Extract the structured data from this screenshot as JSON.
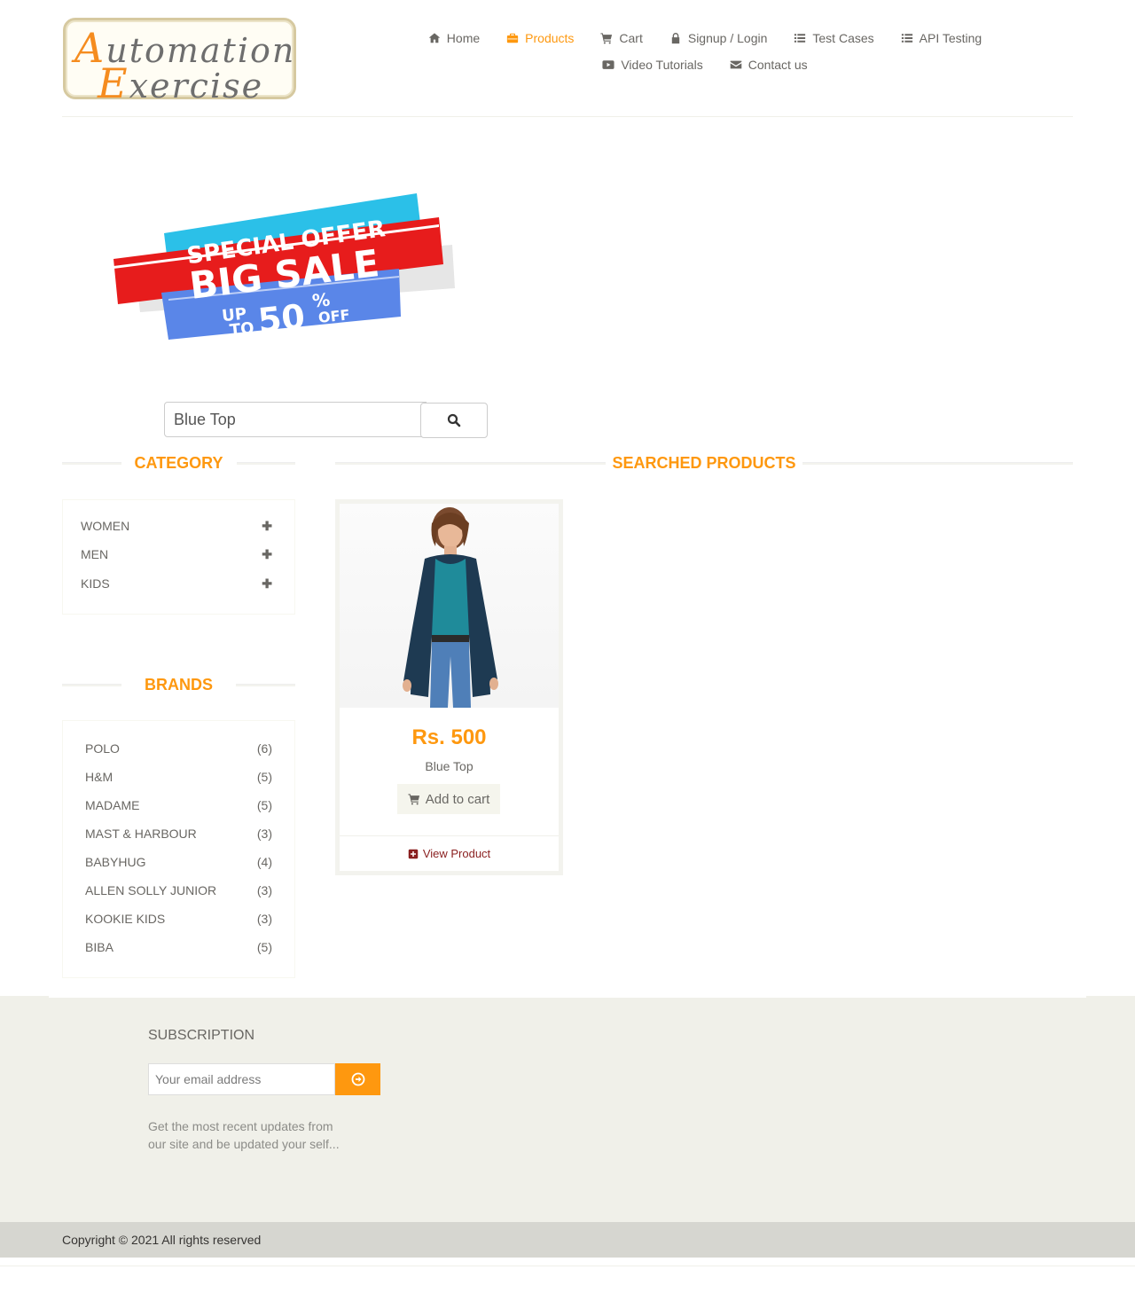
{
  "brand": {
    "logo_line1_first": "A",
    "logo_line1_rest": "utomation",
    "logo_line2_first": "E",
    "logo_line2_rest": "xercise"
  },
  "nav": {
    "items": [
      {
        "label": "Home",
        "icon": "home-icon",
        "active": false
      },
      {
        "label": "Products",
        "icon": "briefcase-icon",
        "active": true
      },
      {
        "label": "Cart",
        "icon": "cart-icon",
        "active": false
      },
      {
        "label": "Signup / Login",
        "icon": "lock-icon",
        "active": false
      },
      {
        "label": "Test Cases",
        "icon": "list-icon",
        "active": false
      },
      {
        "label": "API Testing",
        "icon": "list-icon",
        "active": false
      },
      {
        "label": "Video Tutorials",
        "icon": "youtube-play-icon",
        "active": false
      },
      {
        "label": "Contact us",
        "icon": "envelope-icon",
        "active": false
      }
    ]
  },
  "banner": {
    "special_offer": "SPECIAL OFFER",
    "big_sale": "BIG SALE",
    "up": "UP",
    "to": "TO",
    "fifty": "50",
    "percent": "%",
    "off": "OFF"
  },
  "search": {
    "value": "Blue Top"
  },
  "sidebar": {
    "category_title": "CATEGORY",
    "categories": [
      "WOMEN",
      "MEN",
      "KIDS"
    ],
    "brands_title": "BRANDS",
    "brands": [
      {
        "name": "POLO",
        "count": "(6)"
      },
      {
        "name": "H&M",
        "count": "(5)"
      },
      {
        "name": "MADAME",
        "count": "(5)"
      },
      {
        "name": "MAST & HARBOUR",
        "count": "(3)"
      },
      {
        "name": "BABYHUG",
        "count": "(4)"
      },
      {
        "name": "ALLEN SOLLY JUNIOR",
        "count": "(3)"
      },
      {
        "name": "KOOKIE KIDS",
        "count": "(3)"
      },
      {
        "name": "BIBA",
        "count": "(5)"
      }
    ]
  },
  "main": {
    "title": "SEARCHED PRODUCTS",
    "products": [
      {
        "price": "Rs. 500",
        "name": "Blue Top",
        "add_to_cart": "Add to cart",
        "view_product": "View Product"
      }
    ]
  },
  "footer": {
    "subscription_title": "SUBSCRIPTION",
    "email_placeholder": "Your email address",
    "subscription_desc": "Get the most recent updates from our site and be updated your self...",
    "copyright": "Copyright © 2021 All rights reserved"
  },
  "colors": {
    "accent": "#FE980F",
    "text": "#696763",
    "footer_bg": "#F0F0E9",
    "footer_bottom_bg": "#D6D6D0",
    "view_product_link": "#8a1f1f"
  }
}
